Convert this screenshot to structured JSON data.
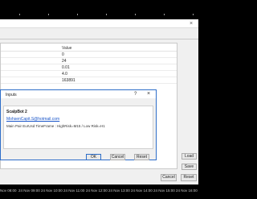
{
  "props_dialog": {
    "close_glyph": "×",
    "value_header": "Value",
    "rows": [
      "0",
      "24",
      "0.01",
      "4.0",
      "163891"
    ],
    "load_label": "Load",
    "save_label": "Save",
    "bottom_buttons": [
      "Cancel",
      "Reset"
    ]
  },
  "inputs_dialog": {
    "title": "Inputs",
    "help_glyph": "?",
    "close_glyph": "×",
    "ea_name": "ScalpBot 2",
    "email": "MohsenCapit.S@hotmail.com",
    "description": "Main Pair EurUsd TimeFrame : HighRisk=M15 / Low Risk=H1",
    "buttons": [
      "OK",
      "Cancel",
      "Reset"
    ]
  },
  "time_axis": [
    "Nov 08:00",
    "24 Nov 09:00",
    "24 Nov 10:00",
    "24 Nov 11:00",
    "24 Nov 12:00",
    "24 Nov 13:00",
    "24 Nov 14:00",
    "24 Nov 15:00",
    "24 Nov 16:00",
    "24 Nov 17:00",
    "24 Nov"
  ]
}
